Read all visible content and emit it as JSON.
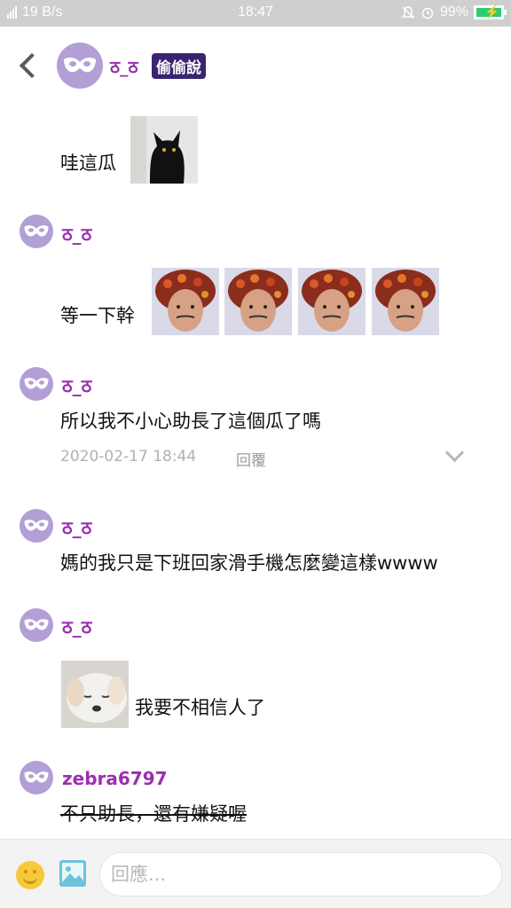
{
  "status_bar": {
    "network": "4G",
    "speed": "19 B/s",
    "time": "18:47",
    "battery": "99%",
    "battery_color": "#2ecc71"
  },
  "header": {
    "back_icon": "chevron-left-icon",
    "avatar_icon": "mask-icon",
    "name": "ठ_ठ",
    "badge": "偷偷說",
    "badge_color": "#3a2470"
  },
  "messages": [
    {
      "user": "",
      "lines": [
        "哇這瓜"
      ],
      "stickers": [
        "black-cat-sticker"
      ]
    },
    {
      "user": "ठ_ठ",
      "lines": [
        "等一下幹"
      ],
      "stickers": [
        "painted-man-sticker",
        "painted-man-sticker",
        "painted-man-sticker",
        "painted-man-sticker"
      ]
    },
    {
      "user": "ठ_ठ",
      "lines": [
        "所以我不小心助長了這個瓜了嗎"
      ],
      "meta": {
        "timestamp": "2020-02-17 18:44",
        "reply_label": "回覆",
        "expand_icon": "chevron-down-icon"
      }
    },
    {
      "user": "ठ_ठ",
      "lines": [
        "媽的我只是下班回家滑手機怎麼變這樣wwww"
      ]
    },
    {
      "user": "ठ_ठ",
      "lines": [
        "我要不相信人了"
      ],
      "stickers": [
        "white-dog-sticker"
      ]
    },
    {
      "user": "zebra6797",
      "lines": [
        "不只助長，還有嫌疑喔"
      ]
    }
  ],
  "composer": {
    "emoji_icon": "emoji-icon",
    "image_icon": "image-icon",
    "placeholder": "回應..."
  }
}
